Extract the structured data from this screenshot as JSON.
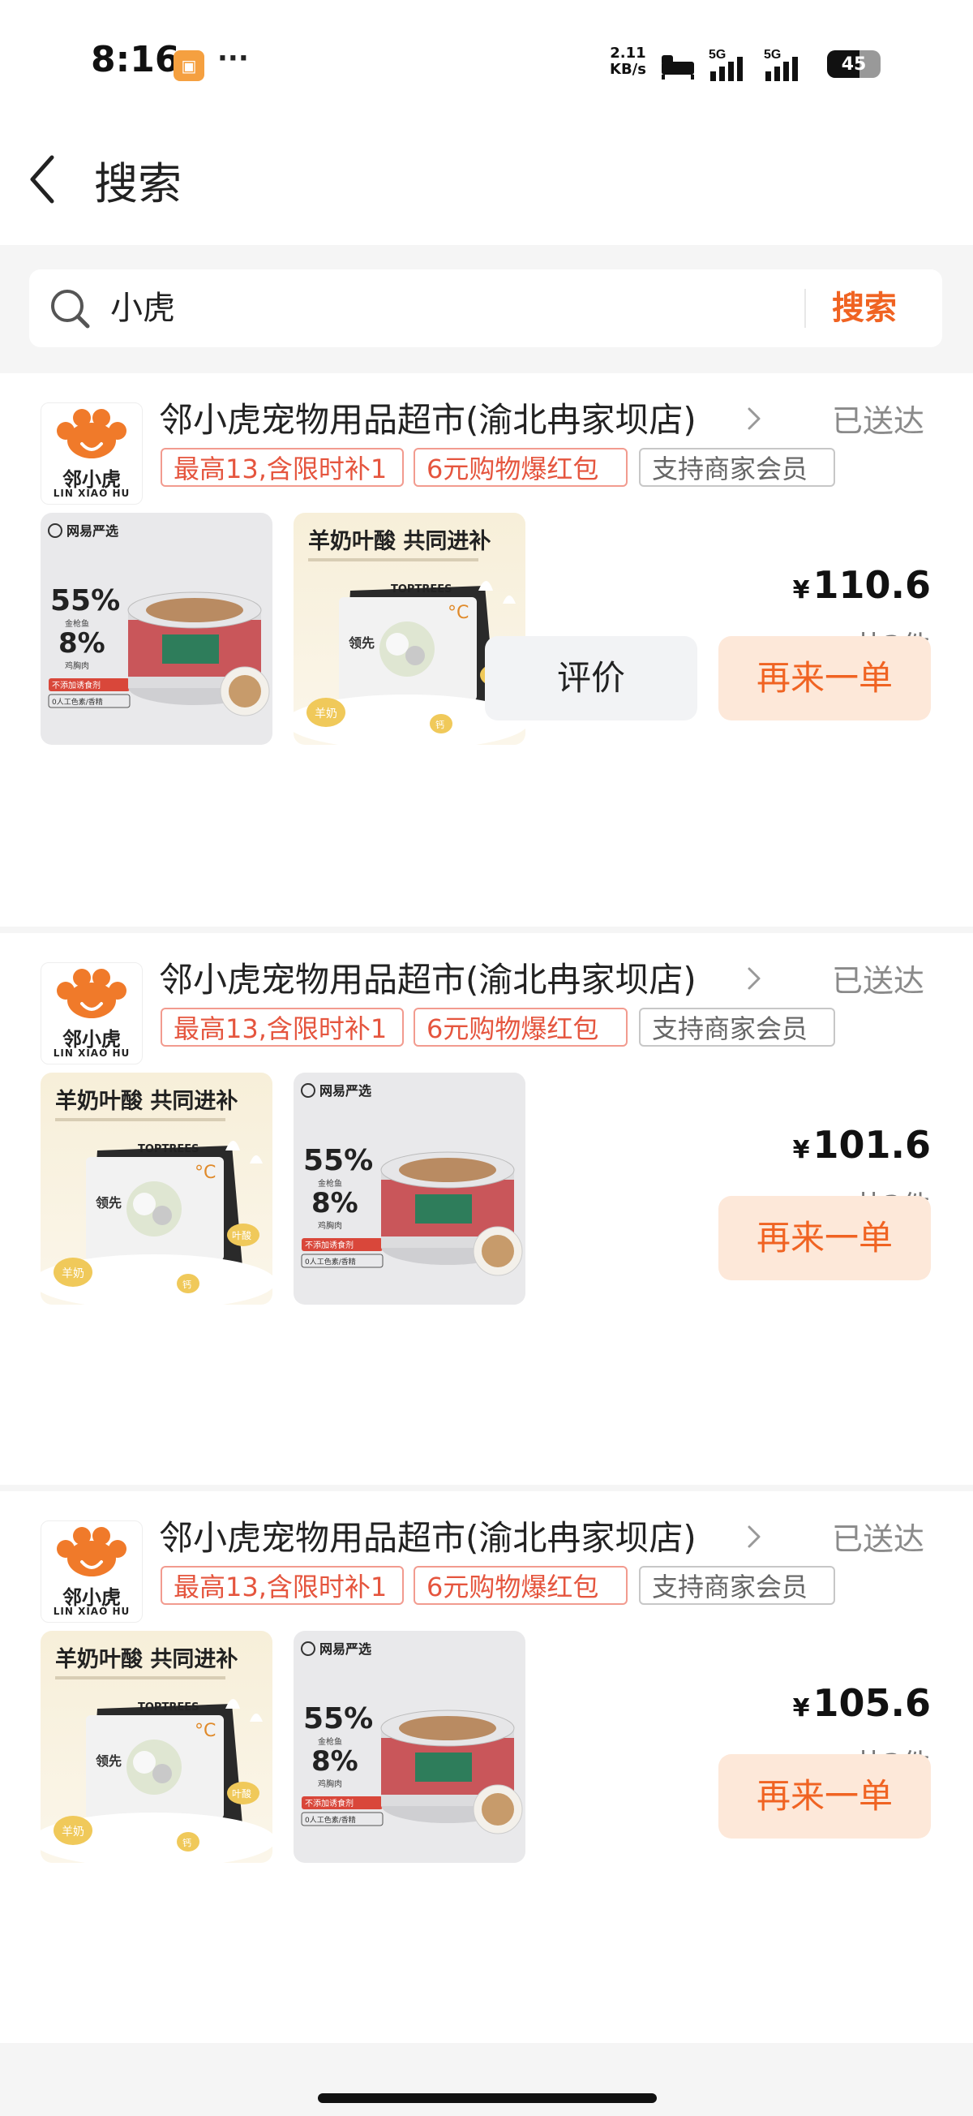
{
  "status_bar": {
    "time": "8:16",
    "speed_top": "2.11",
    "speed_bottom": "KB/s",
    "network1": "5G",
    "network2": "5G",
    "battery": "45"
  },
  "nav": {
    "title": "搜索"
  },
  "search": {
    "query": "小虎",
    "button_label": "搜索"
  },
  "orders": [
    {
      "shop_name": "邻小虎宠物用品超市(渝北冉家坝店)",
      "status": "已送达",
      "tags": [
        "最高13,含限时补1",
        "6元购物爆红包",
        "支持商家会员"
      ],
      "price": "110.6",
      "currency": "¥",
      "count": "共3件",
      "review_label": "评价",
      "reorder_label": "再来一单"
    },
    {
      "shop_name": "邻小虎宠物用品超市(渝北冉家坝店)",
      "status": "已送达",
      "tags": [
        "最高13,含限时补1",
        "6元购物爆红包",
        "支持商家会员"
      ],
      "price": "101.6",
      "currency": "¥",
      "count": "共3件",
      "reorder_label": "再来一单"
    },
    {
      "shop_name": "邻小虎宠物用品超市(渝北冉家坝店)",
      "status": "已送达",
      "tags": [
        "最高13,含限时补1",
        "6元购物爆红包",
        "支持商家会员"
      ],
      "price": "105.6",
      "currency": "¥",
      "count": "共3件",
      "reorder_label": "再来一单"
    }
  ],
  "logo": {
    "name": "邻小虎",
    "sub": "LIN XIAO HU"
  },
  "products": {
    "can": {
      "brand": "网易严选",
      "pct1": "55%",
      "pct1_label": "金枪鱼",
      "pct2": "8%",
      "pct2_label": "鸡胸肉",
      "note1": "不添加诱食剂",
      "note2": "0人工色素/香精"
    },
    "bag": {
      "headline": "羊奶叶酸 共同进补",
      "brand": "TOPTREES",
      "brand_tag": "领先",
      "product": "领先",
      "temp": "°C",
      "label1": "羊奶",
      "label2": "叶酸",
      "label3": "钙"
    }
  },
  "colors": {
    "accent": "#f06322",
    "tag_red": "#e5553e",
    "reorder_bg": "#fde8d9"
  },
  "icons": {
    "back": "chevron-left-icon",
    "search": "search-icon",
    "shop": "chevron-right-icon"
  }
}
